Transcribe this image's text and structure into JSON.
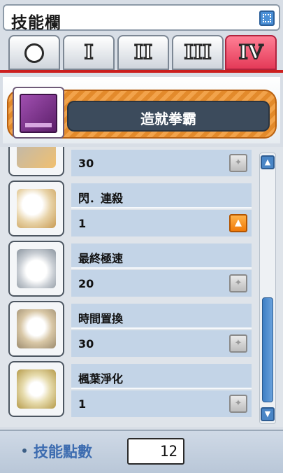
{
  "window": {
    "title": "技能欄"
  },
  "tabs": [
    {
      "label": "",
      "kind": "circle",
      "active": false
    },
    {
      "label": "I",
      "active": false
    },
    {
      "label": "II",
      "active": false
    },
    {
      "label": "III",
      "active": false
    },
    {
      "label": "IV",
      "active": true
    }
  ],
  "job": {
    "name": "造就拳霸",
    "icon": "purple-skill-book-icon"
  },
  "skills": [
    {
      "name": "",
      "level": "30",
      "icon": "partial-skill-icon",
      "upgradable": false
    },
    {
      "name": "閃．連殺",
      "level": "1",
      "icon": "flash-combo-icon",
      "upgradable": true
    },
    {
      "name": "最終極速",
      "level": "20",
      "icon": "final-speed-icon",
      "upgradable": false
    },
    {
      "name": "時間置換",
      "level": "30",
      "icon": "time-leap-icon",
      "upgradable": false
    },
    {
      "name": "楓葉淨化",
      "level": "1",
      "icon": "maple-cleanse-icon",
      "upgradable": false
    }
  ],
  "footer": {
    "sp_label": "技能點數",
    "sp_value": "12"
  },
  "colors": {
    "accent_tab": "#e43a58",
    "upgrade_enabled": "#f07b0a",
    "row_bg": "#c3d4e7"
  }
}
